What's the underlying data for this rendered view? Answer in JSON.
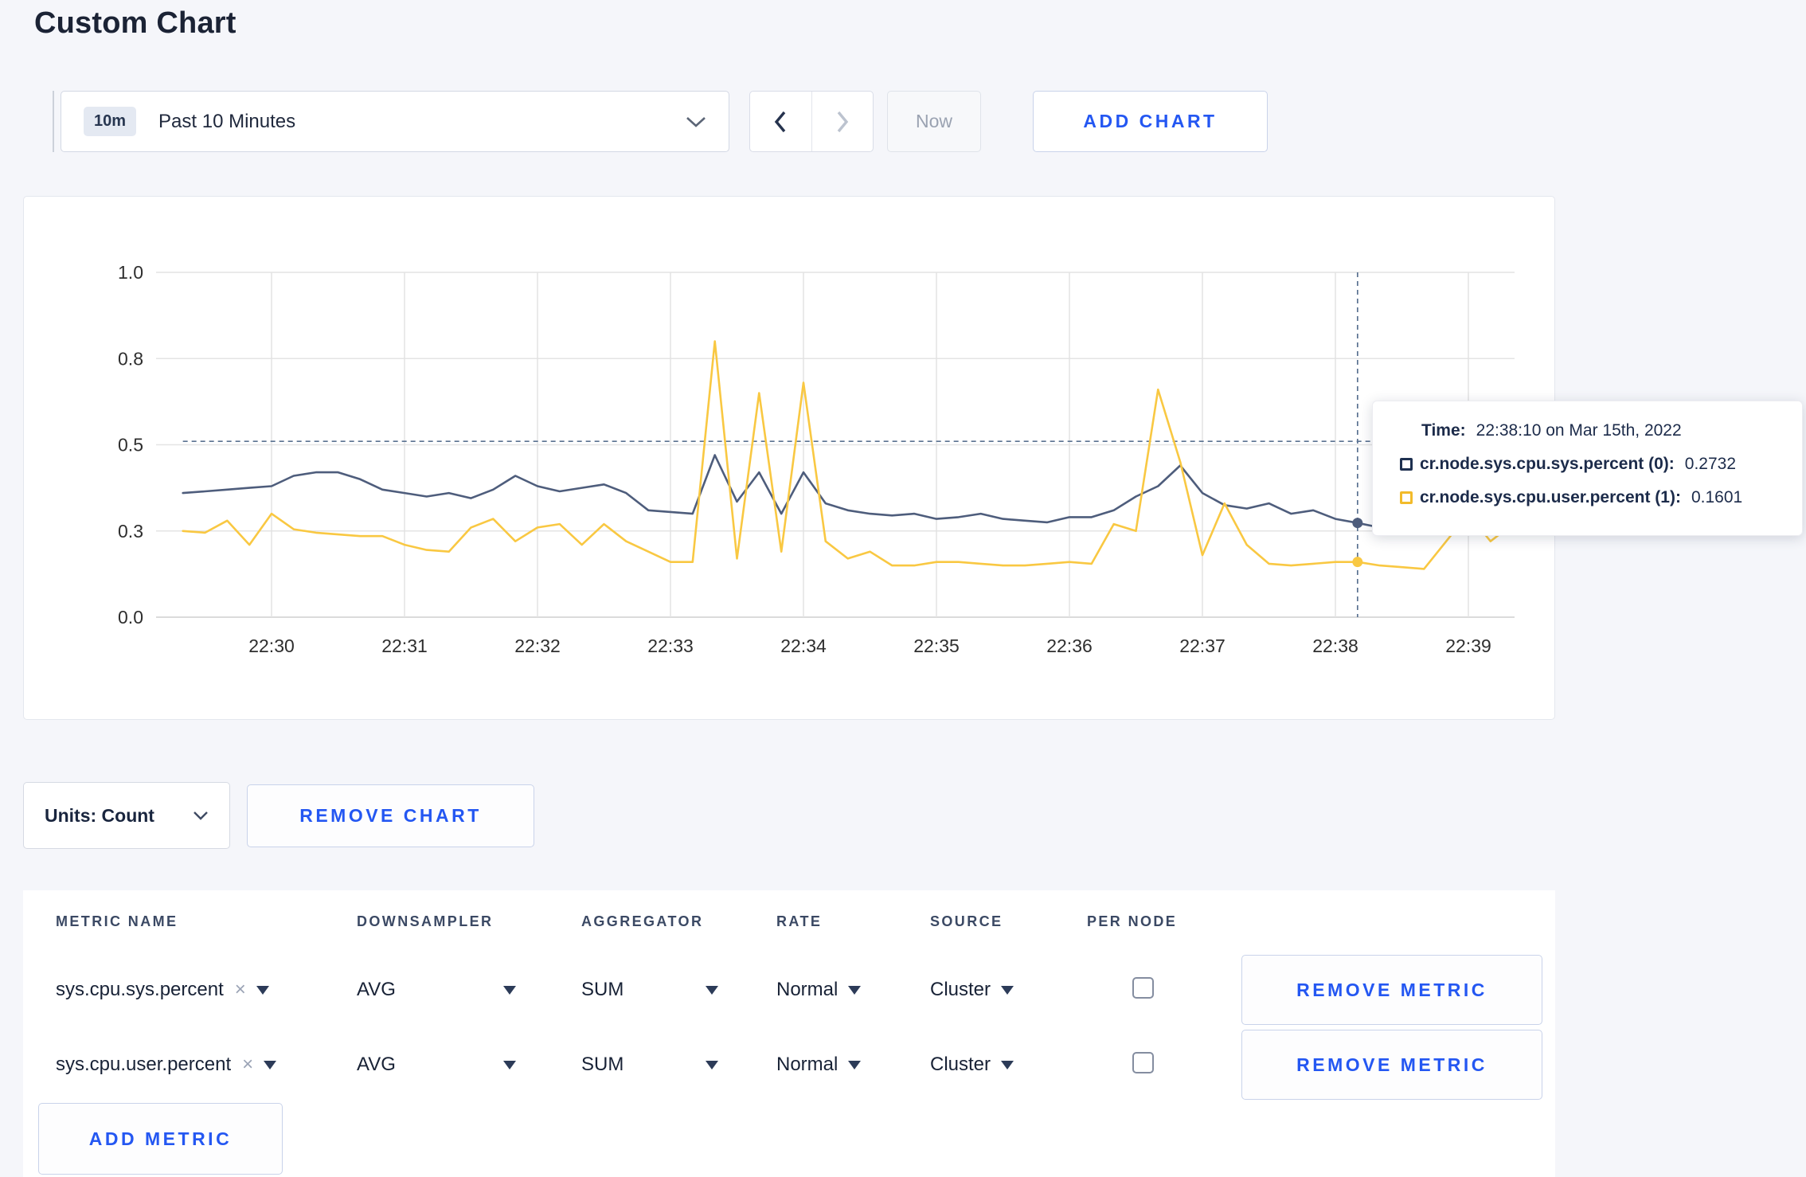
{
  "page": {
    "title": "Custom Chart"
  },
  "toolbar": {
    "time_range": {
      "badge": "10m",
      "label": "Past 10 Minutes"
    },
    "now_label": "Now",
    "add_chart_label": "ADD CHART"
  },
  "chart_controls": {
    "units_label": "Units: Count",
    "remove_chart_label": "REMOVE CHART"
  },
  "ui": {
    "clear_glyph": "×"
  },
  "colors": {
    "accent_blue": "#2457f2",
    "page_bg": "#f5f6fa",
    "crosshair": "#5a7291",
    "series_sys": "#4e5d7c",
    "series_user": "#f9c842"
  },
  "metrics_table": {
    "columns": [
      "METRIC NAME",
      "DOWNSAMPLER",
      "AGGREGATOR",
      "RATE",
      "SOURCE",
      "PER NODE"
    ],
    "rows": [
      {
        "metric": "sys.cpu.sys.percent",
        "downsampler": "AVG",
        "aggregator": "SUM",
        "rate": "Normal",
        "source": "Cluster",
        "per_node_checked": false,
        "remove_label": "REMOVE METRIC"
      },
      {
        "metric": "sys.cpu.user.percent",
        "downsampler": "AVG",
        "aggregator": "SUM",
        "rate": "Normal",
        "source": "Cluster",
        "per_node_checked": false,
        "remove_label": "REMOVE METRIC"
      }
    ],
    "add_metric_label": "ADD METRIC"
  },
  "chart_data": {
    "type": "line",
    "title": "",
    "grid": true,
    "legend_position": "tooltip",
    "ylim": [
      0,
      1
    ],
    "y_axis": {
      "ticks": [
        {
          "value": 0,
          "label": "0.0"
        },
        {
          "value": 0.25,
          "label": "0.3"
        },
        {
          "value": 0.5,
          "label": "0.5"
        },
        {
          "value": 0.75,
          "label": "0.8"
        },
        {
          "value": 1,
          "label": "1.0"
        }
      ]
    },
    "x_axis": {
      "first_tick": "22:30",
      "minutes_per_tick": 1,
      "tick_labels": [
        "22:30",
        "22:31",
        "22:32",
        "22:33",
        "22:34",
        "22:35",
        "22:36",
        "22:37",
        "22:38",
        "22:39"
      ]
    },
    "x_start": "22:29:20",
    "x_interval_seconds": 10,
    "series": [
      {
        "name": "cr.node.sys.cpu.sys.percent",
        "line_color": "#4e5d7c",
        "swatch_color": "#1e3050",
        "values": [
          0.36,
          0.365,
          0.37,
          0.375,
          0.38,
          0.41,
          0.42,
          0.42,
          0.4,
          0.37,
          0.36,
          0.35,
          0.36,
          0.345,
          0.37,
          0.41,
          0.38,
          0.365,
          0.375,
          0.385,
          0.36,
          0.31,
          0.305,
          0.3,
          0.47,
          0.335,
          0.42,
          0.3,
          0.42,
          0.33,
          0.31,
          0.3,
          0.295,
          0.3,
          0.285,
          0.29,
          0.3,
          0.285,
          0.28,
          0.275,
          0.29,
          0.29,
          0.31,
          0.35,
          0.38,
          0.44,
          0.36,
          0.325,
          0.315,
          0.33,
          0.3,
          0.31,
          0.285,
          0.2732,
          0.26,
          0.29,
          0.3,
          0.31,
          0.3,
          0.305,
          0.31
        ]
      },
      {
        "name": "cr.node.sys.cpu.user.percent",
        "line_color": "#f9c842",
        "swatch_color": "#f2bb2b",
        "values": [
          0.25,
          0.245,
          0.28,
          0.21,
          0.3,
          0.255,
          0.245,
          0.24,
          0.235,
          0.235,
          0.21,
          0.195,
          0.19,
          0.26,
          0.285,
          0.22,
          0.26,
          0.27,
          0.21,
          0.27,
          0.22,
          0.19,
          0.16,
          0.16,
          0.8,
          0.17,
          0.65,
          0.19,
          0.68,
          0.22,
          0.17,
          0.19,
          0.15,
          0.15,
          0.16,
          0.16,
          0.155,
          0.15,
          0.15,
          0.155,
          0.16,
          0.155,
          0.27,
          0.25,
          0.66,
          0.45,
          0.18,
          0.33,
          0.21,
          0.155,
          0.15,
          0.155,
          0.16,
          0.1601,
          0.15,
          0.145,
          0.14,
          0.22,
          0.3,
          0.22,
          0.27
        ]
      }
    ],
    "crosshair": {
      "time": "22:38:10",
      "value": 0.51
    },
    "tooltip": {
      "time_label": "Time:",
      "time": "22:38:10 on Mar 15th, 2022",
      "entries": [
        {
          "label": "cr.node.sys.cpu.sys.percent (0):",
          "value": "0.2732"
        },
        {
          "label": "cr.node.sys.cpu.user.percent (1):",
          "value": "0.1601"
        }
      ]
    }
  }
}
